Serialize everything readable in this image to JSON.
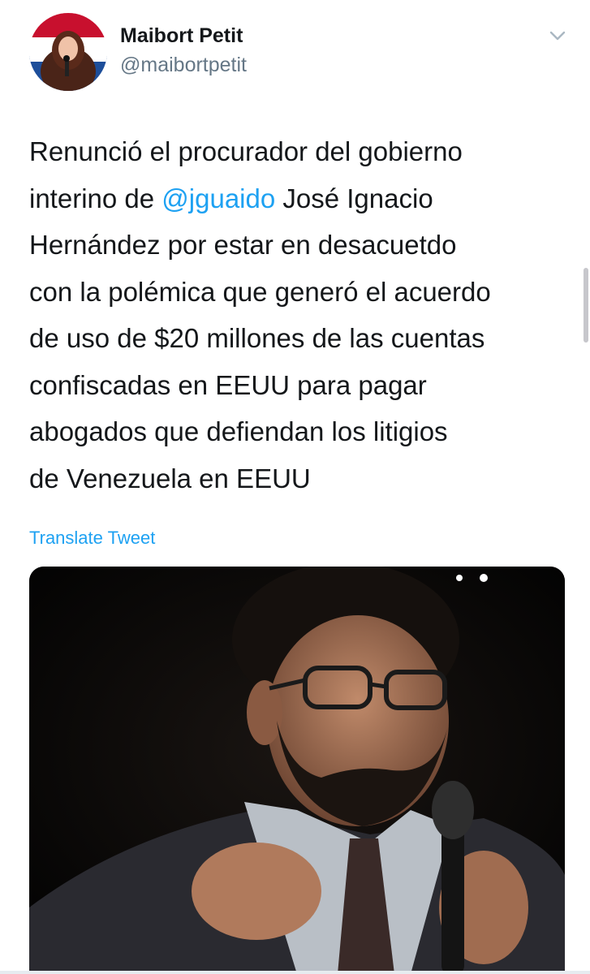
{
  "user": {
    "display_name": "Maibort Petit",
    "handle": "@maibortpetit",
    "avatar_icon": "profile-photo"
  },
  "tweet": {
    "text_before_mention": "Renunció  el procurador del gobierno\ninterino de ",
    "mention": "@jguaido",
    "text_after_mention": " José Ignacio\nHernández  por estar en desacuetdo\ncon la polémica que generó el acuerdo\nde uso de $20 millones de las cuentas\nconfiscadas en EEUU para pagar\nabogados  que defiendan los litigios\nde Venezuela en EEUU",
    "translate_label": "Translate Tweet"
  },
  "colors": {
    "link": "#1da1f2",
    "text": "#14171a",
    "secondary": "#657786"
  },
  "media": {
    "description_icon": "photo-of-man-with-microphone"
  }
}
